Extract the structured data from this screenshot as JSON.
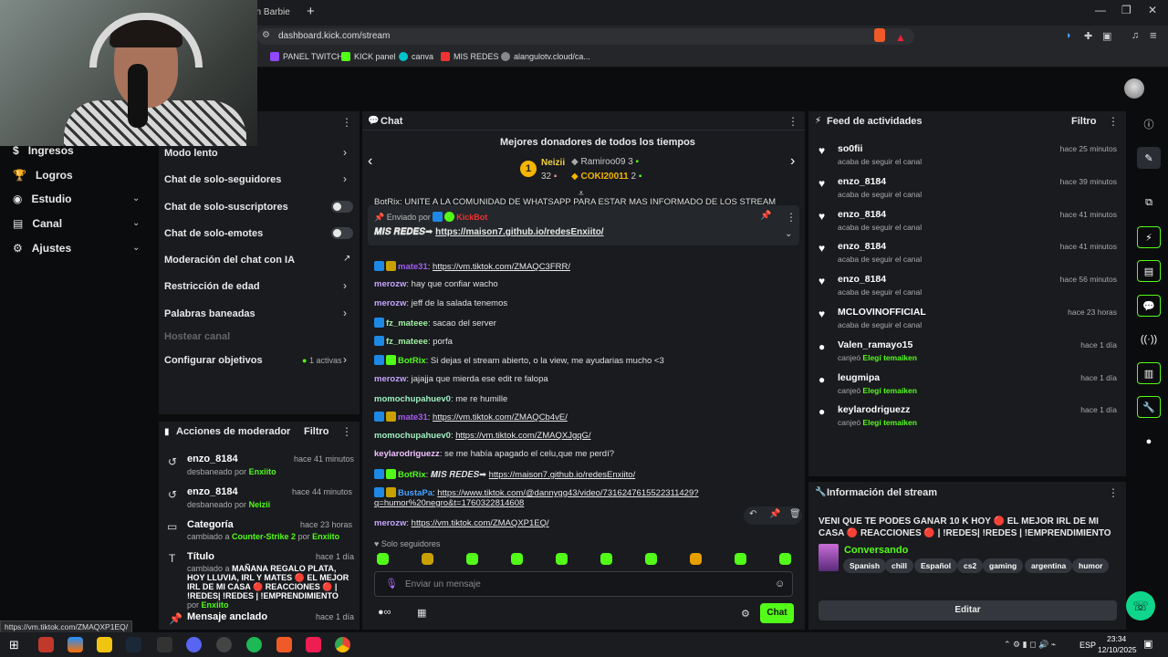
{
  "browser": {
    "tab_title": "con Barbie",
    "url": "dashboard.kick.com/stream",
    "bookmarks": [
      "PANEL TWITCH",
      "KICK panel",
      "canva",
      "MIS REDES",
      "alangulotv.cloud/ca..."
    ],
    "status_url": "https://vm.tiktok.com/ZMAQXP1EQ/"
  },
  "leftnav": {
    "items": [
      {
        "label": "Ingresos",
        "icon": "income-icon"
      },
      {
        "label": "Logros",
        "icon": "trophy-icon"
      },
      {
        "label": "Estudio",
        "icon": "studio-icon"
      },
      {
        "label": "Canal",
        "icon": "channel-icon"
      },
      {
        "label": "Ajustes",
        "icon": "gear-icon"
      }
    ]
  },
  "settings": {
    "rows": [
      {
        "label": "Modo lento"
      },
      {
        "label": "Chat de solo-seguidores"
      },
      {
        "label": "Chat de solo-suscriptores"
      },
      {
        "label": "Chat de solo-emotes"
      },
      {
        "label": "Moderación del chat con IA"
      },
      {
        "label": "Restricción de edad"
      },
      {
        "label": "Palabras baneadas"
      },
      {
        "label": "Hostear canal"
      },
      {
        "label": "Configurar objetivos",
        "extra": "1 activas"
      }
    ]
  },
  "mod": {
    "title": "Acciones de moderador",
    "filter": "Filtro",
    "items": [
      {
        "user": "enzo_8184",
        "action": "desbaneado por",
        "by": "Enxiito",
        "time": "hace 41 minutos"
      },
      {
        "user": "enzo_8184",
        "action": "desbaneado por",
        "by": "Neizii",
        "time": "hace 44 minutos"
      },
      {
        "title": "Categoría",
        "action": "cambiado a",
        "target": "Counter-Strike 2",
        "mid": "por",
        "by": "Enxiito",
        "time": "hace 23 horas"
      },
      {
        "title": "Título",
        "action": "cambiado a",
        "target": "MAÑANA REGALO PLATA, HOY LLUVIA, IRL Y MATES 🔴 EL MEJOR IRL DE MI CASA 🔴 REACCIONES 🔴 | !REDES| !REDES | !EMPRENDIMIENTO",
        "mid": "por",
        "by": "Enxiito",
        "time": "hace 1 día"
      },
      {
        "title": "Mensaje anclado",
        "time": "hace 1 día"
      }
    ]
  },
  "chat": {
    "title": "Chat",
    "donors_title": "Mejores donadores de todos los tiempos",
    "donors": [
      {
        "rank": "1",
        "name": "Neizii",
        "amount": "32"
      },
      {
        "name": "Ramiroo09",
        "amount": "3"
      },
      {
        "name": "COKI20011",
        "amount": "2"
      }
    ],
    "top_cut": "BotRix: UNITE A LA COMUNIDAD DE WHATSAPP PARA ESTAR MAS INFORMADO DE LOS STREAMS",
    "pinned": {
      "label": "Enviado por",
      "by": "KickBot",
      "prefix": "𝑴𝑰𝑺 𝑹𝑬𝑫𝑬𝑺➡",
      "link": "https://maison7.github.io/redesEnxiito/"
    },
    "messages": [
      {
        "user": "mate31",
        "color": "#a45cf0",
        "text": "https://vm.tiktok.com/ZMAQC3FRR/",
        "link": true,
        "badges": [
          "#1e88e5",
          "#c8a000"
        ]
      },
      {
        "user": "merozw",
        "color": "#c7a4ff",
        "text": "hay que confiar wacho"
      },
      {
        "user": "merozw",
        "color": "#c7a4ff",
        "text": "jeff de la salada tenemos"
      },
      {
        "user": "fz_mateee",
        "color": "#a0f0a0",
        "text": "sacao del server",
        "badges": [
          "#1e88e5"
        ]
      },
      {
        "user": "fz_mateee",
        "color": "#a0f0a0",
        "text": "porfa",
        "badges": [
          "#1e88e5"
        ]
      },
      {
        "user": "BotRix",
        "color": "#53fc18",
        "text": "Si dejas el stream abierto, o la view, me ayudarias mucho <3",
        "badges": [
          "#1e88e5",
          "#53fc18"
        ]
      },
      {
        "user": "merozw",
        "color": "#c7a4ff",
        "text": "jajajja que mierda ese edit re falopa"
      },
      {
        "user": "momochupahuev0",
        "color": "#a0f0c0",
        "text": "me re humille"
      },
      {
        "user": "mate31",
        "color": "#a45cf0",
        "text": "https://vm.tiktok.com/ZMAQCb4vE/",
        "link": true,
        "badges": [
          "#1e88e5",
          "#c8a000"
        ]
      },
      {
        "user": "momochupahuev0",
        "color": "#a0f0c0",
        "text": "https://vm.tiktok.com/ZMAQXJgqG/",
        "link": true
      },
      {
        "user": "keylarodriguezz",
        "color": "#f0c0ff",
        "text": "se me había apagado el celu,que me perdí?"
      },
      {
        "user": "BotRix",
        "color": "#53fc18",
        "text": "𝑴𝑰𝑺 𝑹𝑬𝑫𝑬𝑺➡",
        "link2": "https://maison7.github.io/redesEnxiito/",
        "badges": [
          "#1e88e5",
          "#53fc18"
        ]
      },
      {
        "user": "BustaPa",
        "color": "#4aa3ff",
        "text": "https://www.tiktok.com/@dannygg43/video/7316247615522311429?",
        "text2": "q=humor%20negro&t=1760322814608",
        "link": true,
        "badges": [
          "#1e88e5",
          "#c8a000"
        ]
      },
      {
        "user": "merozw",
        "color": "#c7a4ff",
        "text": "https://vm.tiktok.com/ZMAQXP1EQ/",
        "link": true
      }
    ],
    "followers_only": "Solo seguidores",
    "input_placeholder": "Enviar un mensaje",
    "send": "Chat"
  },
  "activity": {
    "title": "Feed de actividades",
    "filter": "Filtro",
    "items": [
      {
        "user": "so0fii",
        "text": "acaba de seguir el canal",
        "time": "hace 25 minutos",
        "icon": "heart"
      },
      {
        "user": "enzo_8184",
        "text": "acaba de seguir el canal",
        "time": "hace 39 minutos",
        "icon": "heart"
      },
      {
        "user": "enzo_8184",
        "text": "acaba de seguir el canal",
        "time": "hace 41 minutos",
        "icon": "heart"
      },
      {
        "user": "enzo_8184",
        "text": "acaba de seguir el canal",
        "time": "hace 41 minutos",
        "icon": "heart"
      },
      {
        "user": "enzo_8184",
        "text": "acaba de seguir el canal",
        "time": "hace 56 minutos",
        "icon": "heart"
      },
      {
        "user": "MCLOVINOFFICIAL",
        "text": "acaba de seguir el canal",
        "time": "hace 23 horas",
        "icon": "heart"
      },
      {
        "user": "Valen_ramayo15",
        "text": "canjeó",
        "reward": "Elegí temaiken",
        "time": "hace 1 día",
        "icon": "points"
      },
      {
        "user": "leugmipa",
        "text": "canjeó",
        "reward": "Elegí temaiken",
        "time": "hace 1 día",
        "icon": "points"
      },
      {
        "user": "keylarodriguezz",
        "text": "canjeó",
        "reward": "Elegí temaiken",
        "time": "hace 1 día",
        "icon": "points"
      }
    ]
  },
  "stream_info": {
    "title": "Información del stream",
    "stream_title": "VENI QUE TE PODES GANAR 10 K HOY 🔴 EL MEJOR IRL DE MI CASA 🔴 REACCIONES 🔴 | !REDES| !REDES | !EMPRENDIMIENTO",
    "category": "Conversando",
    "tags": [
      "Spanish",
      "chill",
      "Español",
      "cs2",
      "gaming",
      "argentina",
      "humor"
    ],
    "edit": "Editar"
  },
  "taskbar": {
    "lang": "ESP",
    "time": "23:34",
    "date": "12/10/2025"
  }
}
